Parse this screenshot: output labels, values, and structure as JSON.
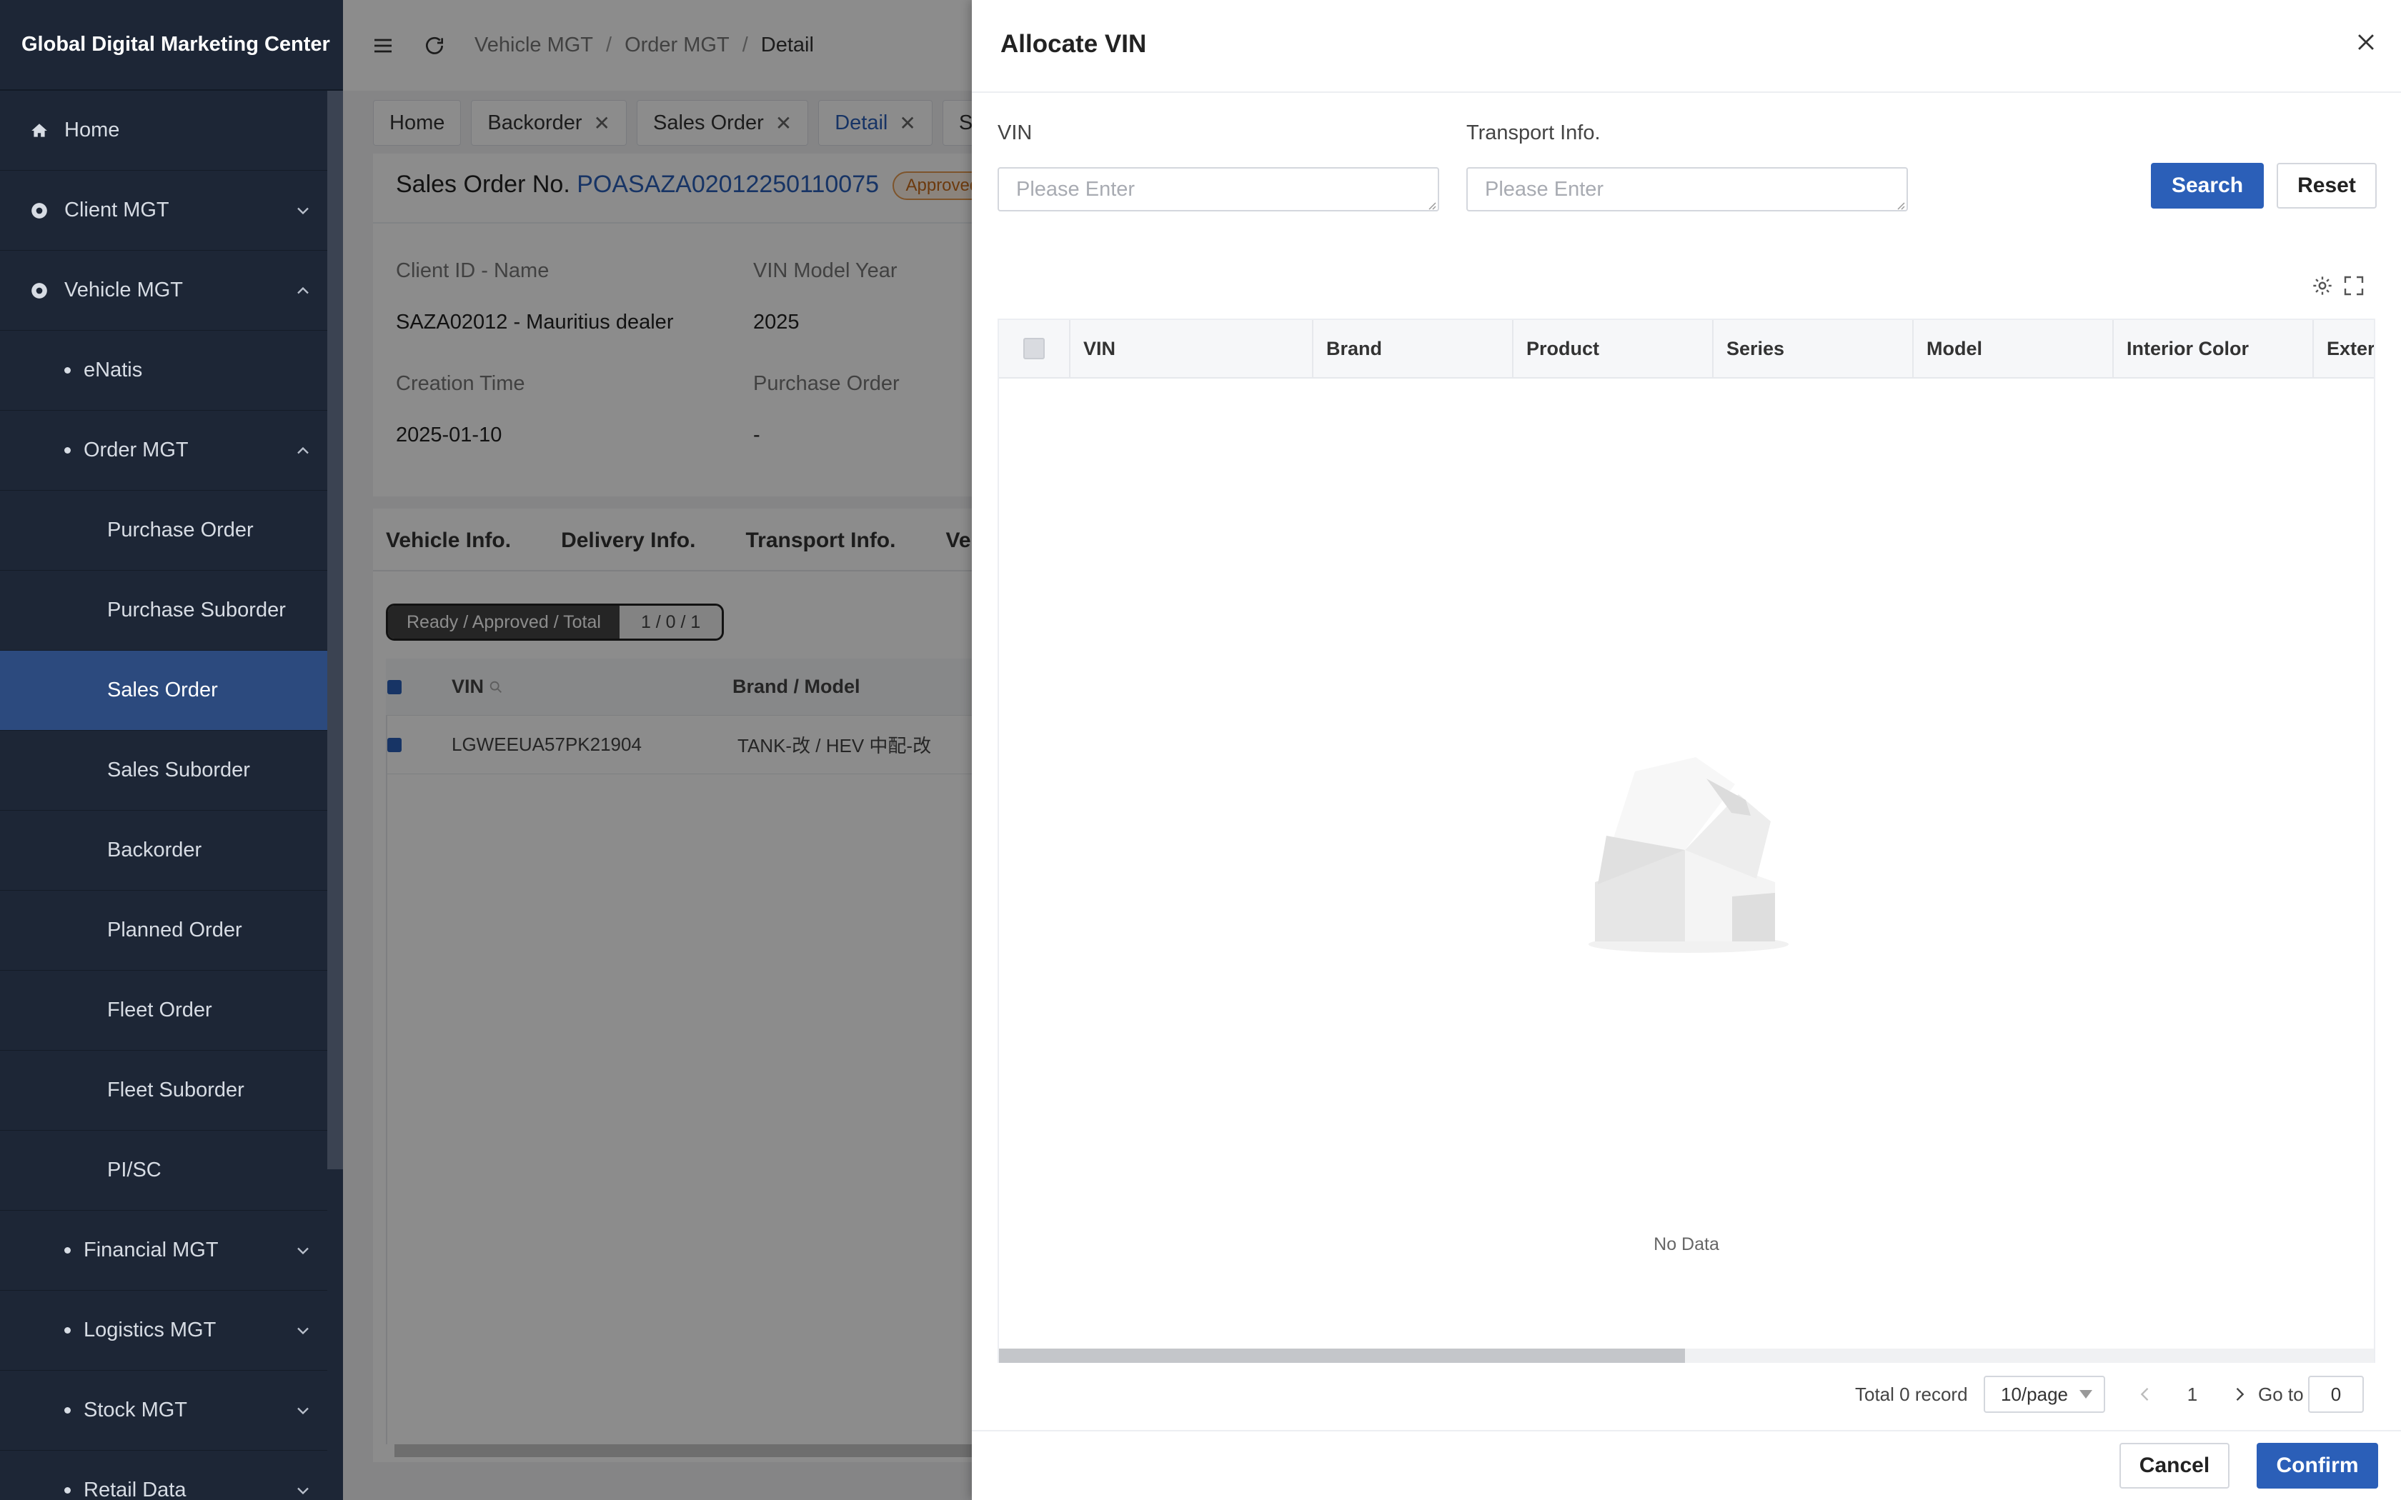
{
  "app": {
    "title": "Global Digital Marketing Center"
  },
  "sidebar": {
    "items": [
      {
        "label": "Home"
      },
      {
        "label": "Client MGT"
      },
      {
        "label": "Vehicle MGT"
      },
      {
        "label": "eNatis"
      },
      {
        "label": "Order MGT"
      },
      {
        "label": "Purchase Order"
      },
      {
        "label": "Purchase Suborder"
      },
      {
        "label": "Sales Order"
      },
      {
        "label": "Sales Suborder"
      },
      {
        "label": "Backorder"
      },
      {
        "label": "Planned Order"
      },
      {
        "label": "Fleet Order"
      },
      {
        "label": "Fleet Suborder"
      },
      {
        "label": "PI/SC"
      },
      {
        "label": "Financial MGT"
      },
      {
        "label": "Logistics MGT"
      },
      {
        "label": "Stock MGT"
      },
      {
        "label": "Retail Data"
      }
    ]
  },
  "breadcrumb": {
    "items": [
      "Vehicle MGT",
      "Order MGT",
      "Detail"
    ],
    "sep": "/"
  },
  "tabs": [
    {
      "label": "Home"
    },
    {
      "label": "Backorder"
    },
    {
      "label": "Sales Order"
    },
    {
      "label": "Detail"
    },
    {
      "label": "Sto"
    }
  ],
  "order": {
    "title_prefix": "Sales Order No.",
    "number": "POASAZA02012250110075",
    "status": "Approved",
    "fields": {
      "client_label": "Client ID - Name",
      "client_value": "SAZA02012 - Mauritius dealer",
      "model_year_label": "VIN Model Year",
      "model_year_value": "2025",
      "creation_label": "Creation Time",
      "creation_value": "2025-01-10",
      "po_label": "Purchase Order",
      "po_value": "-"
    },
    "subtabs": [
      "Vehicle Info.",
      "Delivery Info.",
      "Transport Info.",
      "Vehicle"
    ],
    "counter_label": "Ready / Approved / Total",
    "counter_value": "1 / 0 / 1",
    "table": {
      "headers": [
        "VIN",
        "Brand / Model"
      ],
      "rows": [
        {
          "vin": "LGWEEUA57PK21904",
          "brand_model": "TANK-改 / HEV 中配-改"
        }
      ]
    }
  },
  "drawer": {
    "title": "Allocate VIN",
    "vin_label": "VIN",
    "vin_placeholder": "Please Enter",
    "transport_label": "Transport Info.",
    "transport_placeholder": "Please Enter",
    "search_label": "Search",
    "reset_label": "Reset",
    "columns": [
      "VIN",
      "Brand",
      "Product",
      "Series",
      "Model",
      "Interior Color",
      "Exteri"
    ],
    "empty_text": "No Data",
    "pagination": {
      "total_text": "Total 0 record",
      "page_size": "10/page",
      "current_page": "1",
      "goto_label": "Go to",
      "goto_value": "0"
    },
    "cancel_label": "Cancel",
    "confirm_label": "Confirm"
  },
  "colors": {
    "primary": "#2b5fb8",
    "sidebar_bg": "#1d2636",
    "active_menu": "#2c4a7e",
    "badge": "#e69a4f"
  },
  "icons": [
    "home-icon",
    "client-icon",
    "vehicle-icon",
    "chevron-down-icon",
    "chevron-up-icon",
    "menu-fold-icon",
    "refresh-icon",
    "close-icon",
    "settings-icon",
    "fullscreen-icon",
    "chevron-left-icon",
    "chevron-right-icon",
    "empty-box-icon"
  ]
}
